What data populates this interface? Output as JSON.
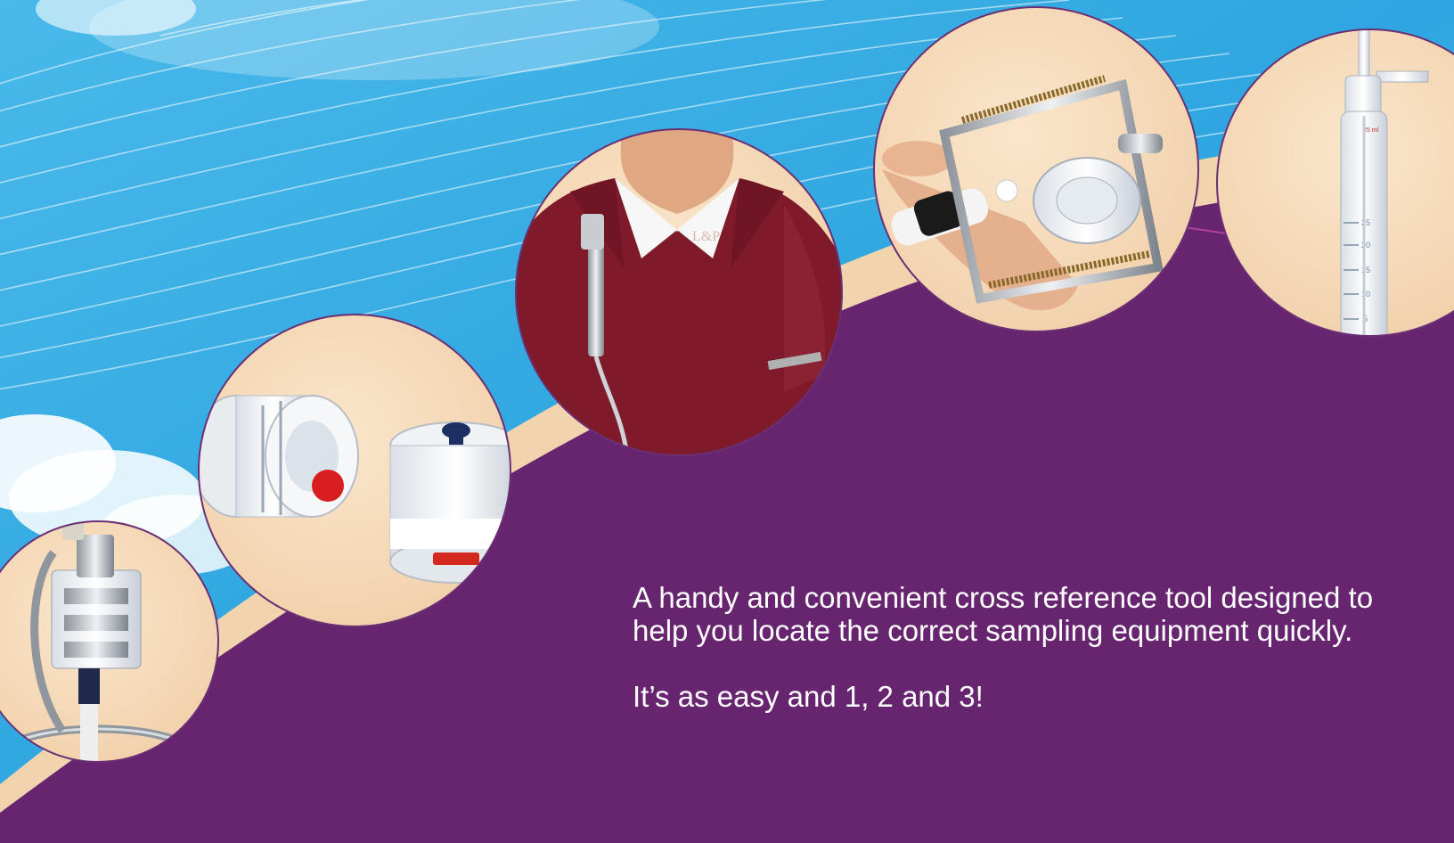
{
  "brochure": {
    "description": "A handy and convenient cross reference tool designed to help you locate the correct sampling equipment quickly.",
    "tagline": "It’s as easy and 1, 2 and 3!"
  },
  "photos": [
    {
      "name": "sampler-with-tubing"
    },
    {
      "name": "filter-cassettes"
    },
    {
      "name": "worn-sampler-on-shirt"
    },
    {
      "name": "cassette-holder-clamp"
    },
    {
      "name": "glass-impinger"
    }
  ],
  "colors": {
    "sky": "#3fb3e6",
    "sky_light": "#8fd6f4",
    "band_peach": "#f4d6b3",
    "purple": "#6a2472",
    "text": "#ffffff"
  }
}
